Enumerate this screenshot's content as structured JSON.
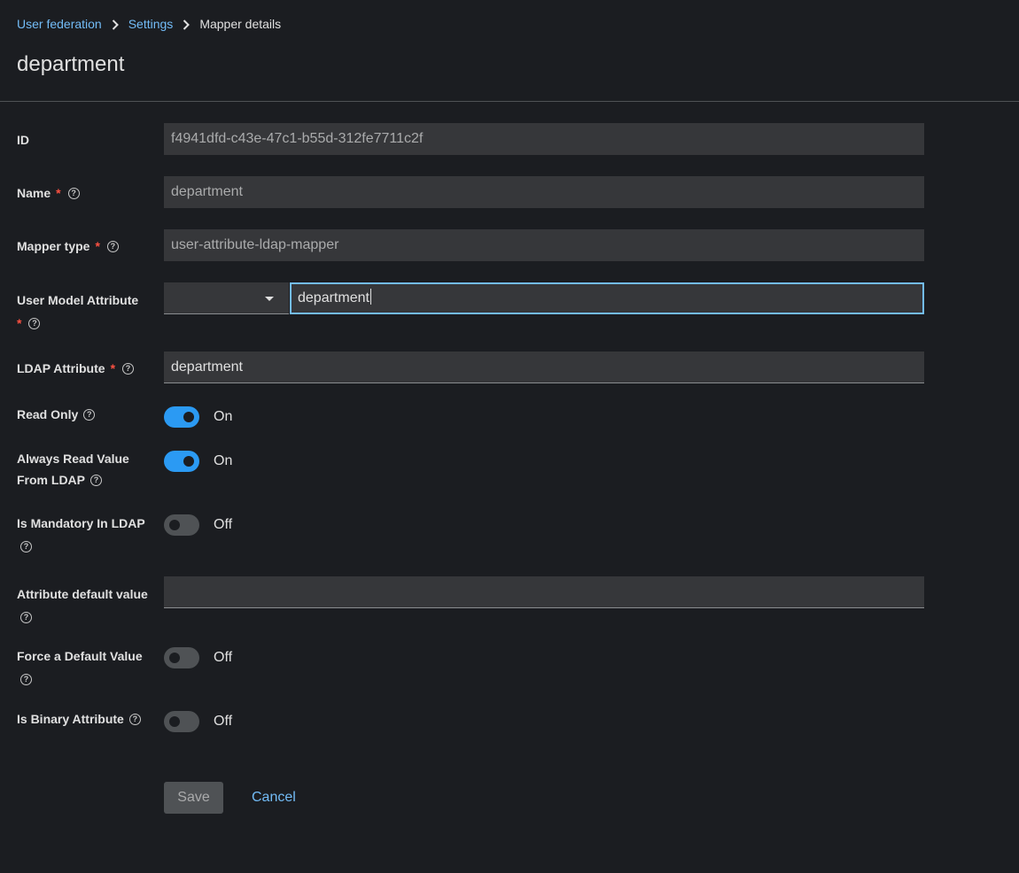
{
  "breadcrumb": {
    "items": [
      "User federation",
      "Settings"
    ],
    "current": "Mapper details"
  },
  "page": {
    "title": "department"
  },
  "form": {
    "id": {
      "label": "ID",
      "value": "f4941dfd-c43e-47c1-b55d-312fe7711c2f"
    },
    "name": {
      "label": "Name",
      "required": "*",
      "value": "department"
    },
    "mapper_type": {
      "label": "Mapper type",
      "required": "*",
      "value": "user-attribute-ldap-mapper"
    },
    "user_model_attribute": {
      "label": "User Model Attribute",
      "required": "*",
      "select_value": "",
      "value": "department"
    },
    "ldap_attribute": {
      "label": "LDAP Attribute",
      "required": "*",
      "value": "department"
    },
    "read_only": {
      "label": "Read Only",
      "state": "On",
      "checked": true
    },
    "always_read": {
      "label_line1": "Always Read Value",
      "label_line2": "From LDAP",
      "state": "On",
      "checked": true
    },
    "is_mandatory": {
      "label": "Is Mandatory In LDAP",
      "state": "Off",
      "checked": false
    },
    "attribute_default": {
      "label": "Attribute default value",
      "value": ""
    },
    "force_default": {
      "label": "Force a Default Value",
      "state": "Off",
      "checked": false
    },
    "is_binary": {
      "label": "Is Binary Attribute",
      "state": "Off",
      "checked": false
    }
  },
  "actions": {
    "save": "Save",
    "cancel": "Cancel"
  },
  "icons": {
    "help": "help-icon",
    "chevron": "chevron-right-icon",
    "caret": "caret-down-icon"
  },
  "colors": {
    "link": "#73bcf7",
    "switch_on": "#2b9af3",
    "required": "#fe5142",
    "background": "#1b1d21"
  }
}
